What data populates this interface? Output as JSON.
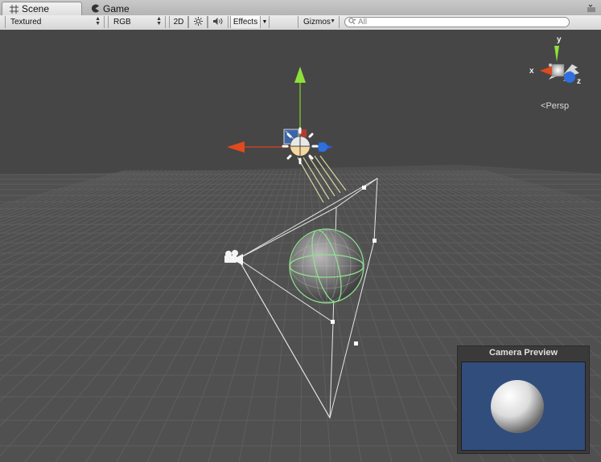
{
  "tabs": [
    {
      "label": "Scene"
    },
    {
      "label": "Game"
    }
  ],
  "toolbar": {
    "shading_mode": "Textured",
    "render_mode": "RGB",
    "mode_2d": "2D",
    "effects_label": "Effects",
    "gizmos_label": "Gizmos",
    "search_placeholder": "All"
  },
  "gizmo": {
    "x_label": "x",
    "y_label": "y",
    "z_label": "z",
    "projection": "Persp"
  },
  "camera_preview": {
    "title": "Camera Preview"
  },
  "colors": {
    "viewport_bg": "#464646",
    "x_axis": "#e0401e",
    "y_axis": "#7fd12b",
    "z_axis": "#2f5fd6",
    "preview_bg": "#314d7c",
    "collider_green": "#8fe08f"
  }
}
